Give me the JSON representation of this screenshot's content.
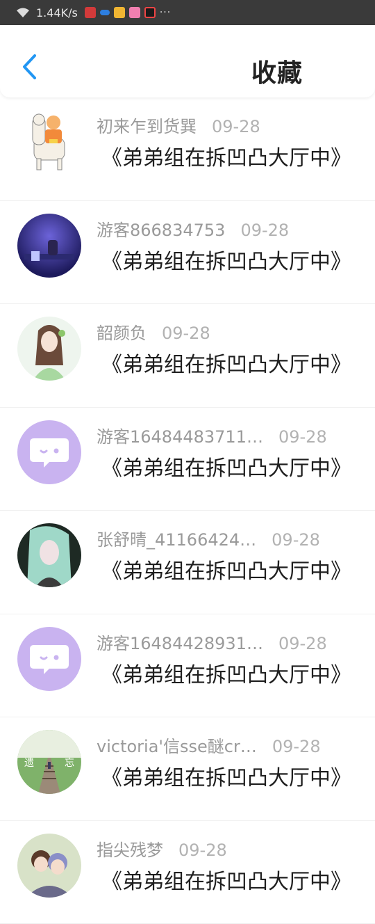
{
  "status_bar": {
    "speed": "1.44K/s",
    "icons": [
      "wifi-icon",
      "mic-icon",
      "cloud-icon",
      "app-icon",
      "shop-icon",
      "video-icon",
      "more-icon"
    ],
    "more": "···"
  },
  "header": {
    "title": "收藏",
    "back_icon": "chevron-left-icon",
    "accent": "#2196f3"
  },
  "items": [
    {
      "name": "初来乍到货巽",
      "date": "09-28",
      "book": "《弟弟组在拆凹凸大厅中》",
      "avatar": "alpaca"
    },
    {
      "name": "游客866834753",
      "date": "09-28",
      "book": "《弟弟组在拆凹凸大厅中》",
      "avatar": "night-room"
    },
    {
      "name": "韶颜负",
      "date": "09-28",
      "book": "《弟弟组在拆凹凸大厅中》",
      "avatar": "girl-green"
    },
    {
      "name": "游客16484483711…",
      "date": "09-28",
      "book": "《弟弟组在拆凹凸大厅中》",
      "avatar": "chat-bubble"
    },
    {
      "name": "张舒晴_41166424…",
      "date": "09-28",
      "book": "《弟弟组在拆凹凸大厅中》",
      "avatar": "girl-dark"
    },
    {
      "name": "游客16484428931…",
      "date": "09-28",
      "book": "《弟弟组在拆凹凸大厅中》",
      "avatar": "chat-bubble"
    },
    {
      "name": "victoria'信sse醚cr…",
      "date": "09-28",
      "book": "《弟弟组在拆凹凸大厅中》",
      "avatar": "railway"
    },
    {
      "name": "指尖残梦",
      "date": "09-28",
      "book": "《弟弟组在拆凹凸大厅中》",
      "avatar": "anime-pair"
    }
  ],
  "railway_text": [
    "遗",
    "忘"
  ]
}
